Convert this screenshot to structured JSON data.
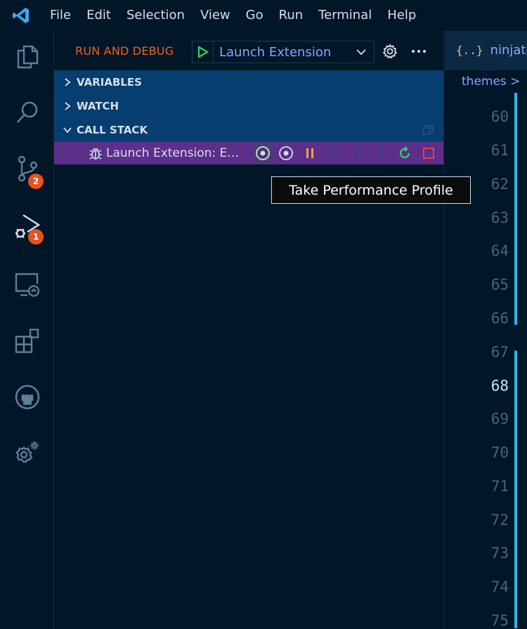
{
  "menubar": {
    "items": [
      "File",
      "Edit",
      "Selection",
      "View",
      "Go",
      "Run",
      "Terminal",
      "Help"
    ]
  },
  "activitybar": {
    "icons": [
      "explorer-icon",
      "search-icon",
      "source-control-icon",
      "run-debug-icon",
      "remote-explorer-icon",
      "extensions-icon",
      "github-icon",
      "manage-gear-icon"
    ],
    "source_control_badge": "2",
    "run_debug_badge": "1"
  },
  "sidebar": {
    "title": "RUN AND DEBUG",
    "launch_config": "Launch Extension",
    "sections": {
      "variables": "VARIABLES",
      "watch": "WATCH",
      "call_stack": "CALL STACK"
    },
    "call_stack_item": "Launch Extension: E…"
  },
  "tooltip": {
    "text": "Take Performance Profile"
  },
  "editor": {
    "tab_icon": "{..}",
    "tab_name": "ninjato.",
    "breadcrumb": "themes >",
    "line_numbers": [
      "60",
      "61",
      "62",
      "63",
      "64",
      "65",
      "66",
      "67",
      "68",
      "69",
      "70",
      "71",
      "72",
      "73",
      "74",
      "75"
    ],
    "active_line": "68"
  },
  "colors": {
    "background": "#011627",
    "accent_orange": "#e8631f",
    "call_stack_highlight": "#5b2f8a",
    "section_bg": "#063e70",
    "play_green": "#22da6e",
    "stop_red": "#ef5350",
    "pause_orange": "#f78c6c"
  }
}
